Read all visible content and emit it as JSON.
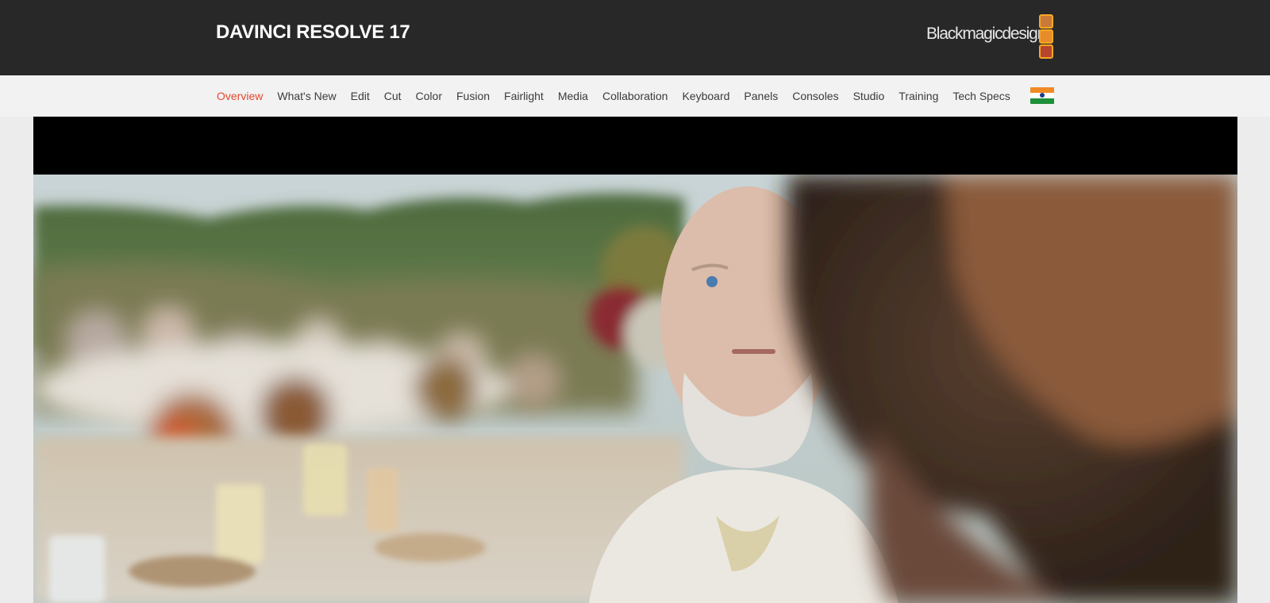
{
  "header": {
    "product_title": "DAVINCI RESOLVE 17",
    "brand_logo_text": "Blackmagicdesign"
  },
  "nav": {
    "items": [
      {
        "label": "Overview",
        "active": true
      },
      {
        "label": "What's New"
      },
      {
        "label": "Edit"
      },
      {
        "label": "Cut"
      },
      {
        "label": "Color"
      },
      {
        "label": "Fusion"
      },
      {
        "label": "Fairlight"
      },
      {
        "label": "Media"
      },
      {
        "label": "Collaboration"
      },
      {
        "label": "Keyboard"
      },
      {
        "label": "Panels"
      },
      {
        "label": "Consoles"
      },
      {
        "label": "Studio"
      },
      {
        "label": "Training"
      },
      {
        "label": "Tech Specs"
      }
    ],
    "region_icon": "india-flag-icon"
  },
  "colors": {
    "header_bg": "#282828",
    "nav_bg": "#f1f2f1",
    "nav_active": "#e8462f",
    "logo_accent": "#f7a823"
  },
  "hero": {
    "image": "film-still-outdoor-banquet"
  }
}
